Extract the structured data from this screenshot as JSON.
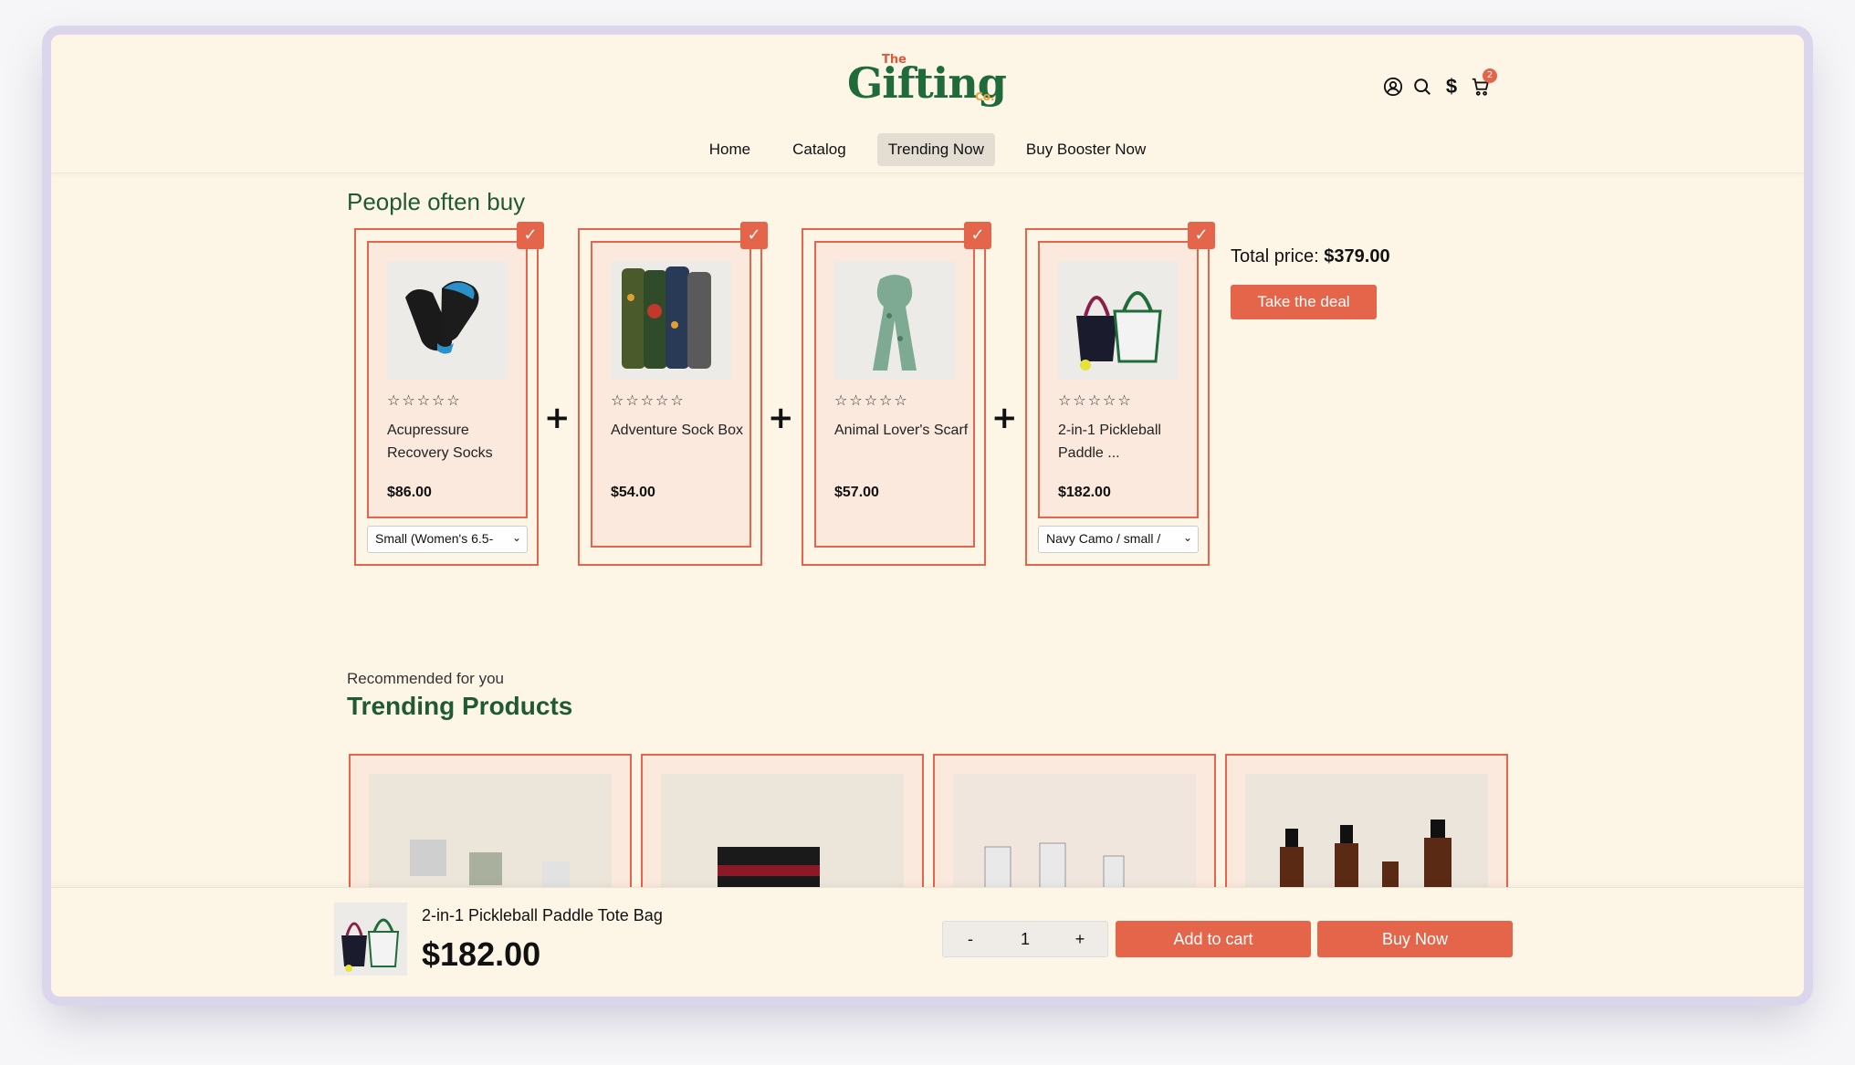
{
  "logo": {
    "the": "The",
    "main": "Gifting",
    "co": "Co."
  },
  "header_icons": {
    "account": "account-icon",
    "search": "search-icon",
    "currency": "$",
    "cart": "cart-icon",
    "cart_count": "2"
  },
  "nav": [
    {
      "label": "Home",
      "active": false
    },
    {
      "label": "Catalog",
      "active": false
    },
    {
      "label": "Trending Now",
      "active": true
    },
    {
      "label": "Buy Booster Now",
      "active": false
    }
  ],
  "people_often_buy": {
    "title": "People often buy",
    "items": [
      {
        "name": "Acupressure Recovery Socks",
        "price": "$86.00",
        "stars": "☆☆☆☆☆",
        "checked": true,
        "variant": "Small (Women's 6.5-"
      },
      {
        "name": "Adventure Sock Box",
        "price": "$54.00",
        "stars": "☆☆☆☆☆",
        "checked": true,
        "variant": null
      },
      {
        "name": "Animal Lover's Scarf",
        "price": "$57.00",
        "stars": "☆☆☆☆☆",
        "checked": true,
        "variant": null
      },
      {
        "name": "2-in-1 Pickleball Paddle ...",
        "price": "$182.00",
        "stars": "☆☆☆☆☆",
        "checked": true,
        "variant": "Navy Camo / small /"
      }
    ],
    "plus": "+",
    "total_label": "Total price:",
    "total_value": "$379.00",
    "deal_button": "Take the deal"
  },
  "trending": {
    "eyebrow": "Recommended for you",
    "title": "Trending Products"
  },
  "sticky_bar": {
    "product_name": "2-in-1 Pickleball Paddle Tote Bag",
    "price": "$182.00",
    "qty_minus": "-",
    "qty_value": "1",
    "qty_plus": "+",
    "add_to_cart": "Add to cart",
    "buy_now": "Buy Now"
  },
  "colors": {
    "accent": "#e5654a",
    "brand_green": "#1f5a34",
    "background": "#fdf6e7"
  }
}
